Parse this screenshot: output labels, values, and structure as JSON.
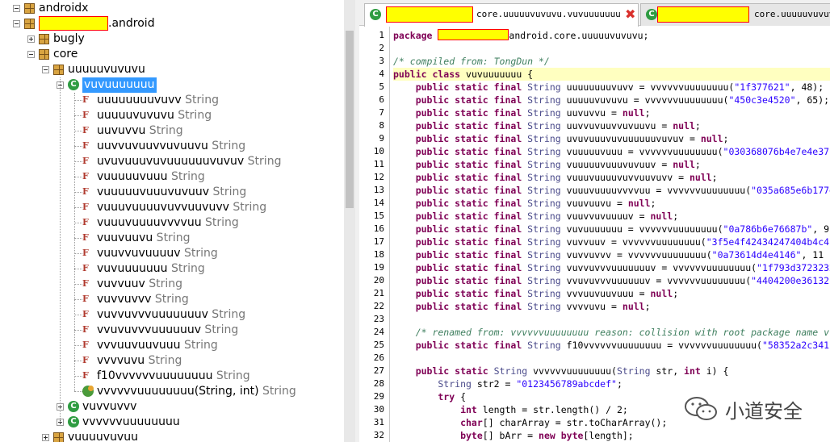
{
  "tree": {
    "nodes": [
      {
        "id": "n0",
        "depth": 0,
        "icon": "package",
        "expander": "minus",
        "label": "androidx",
        "type": ""
      },
      {
        "id": "n1",
        "depth": 0,
        "icon": "package",
        "expander": "minus",
        "label": ".android",
        "type": "",
        "redacted": true
      },
      {
        "id": "n2",
        "depth": 1,
        "icon": "package",
        "expander": "plus",
        "label": "bugly",
        "type": ""
      },
      {
        "id": "n3",
        "depth": 1,
        "icon": "package",
        "expander": "minus",
        "label": "core",
        "type": ""
      },
      {
        "id": "n4",
        "depth": 2,
        "icon": "package",
        "expander": "minus",
        "label": "uuuuuvuvuvu",
        "type": ""
      },
      {
        "id": "n5",
        "depth": 3,
        "icon": "class",
        "expander": "minus",
        "label": "vuvuuuuuuu",
        "type": "",
        "selected": true
      },
      {
        "id": "n6",
        "depth": 4,
        "icon": "field",
        "label": "uuuuuuuuvuvv",
        "type": "String"
      },
      {
        "id": "n7",
        "depth": 4,
        "icon": "field",
        "label": "uuuuuvuvuvu",
        "type": "String"
      },
      {
        "id": "n8",
        "depth": 4,
        "icon": "field",
        "label": "uuvuvvu",
        "type": "String"
      },
      {
        "id": "n9",
        "depth": 4,
        "icon": "field",
        "label": "uuvvuvuuvvuvuuvu",
        "type": "String"
      },
      {
        "id": "n10",
        "depth": 4,
        "icon": "field",
        "label": "uvuvuuuvuvuuuuuuvuvuv",
        "type": "String"
      },
      {
        "id": "n11",
        "depth": 4,
        "icon": "field",
        "label": "vuuuuuvuuu",
        "type": "String"
      },
      {
        "id": "n12",
        "depth": 4,
        "icon": "field",
        "label": "vuuuuuvuuuvuvuuv",
        "type": "String"
      },
      {
        "id": "n13",
        "depth": 4,
        "icon": "field",
        "label": "vuuuvuuuuvuvvuuvuvv",
        "type": "String"
      },
      {
        "id": "n14",
        "depth": 4,
        "icon": "field",
        "label": "vuuuvuuuuvvvvuu",
        "type": "String"
      },
      {
        "id": "n15",
        "depth": 4,
        "icon": "field",
        "label": "vuuvuuvu",
        "type": "String"
      },
      {
        "id": "n16",
        "depth": 4,
        "icon": "field",
        "label": "vuuvvuvuuuuv",
        "type": "String"
      },
      {
        "id": "n17",
        "depth": 4,
        "icon": "field",
        "label": "vuvuuuuuuu",
        "type": "String"
      },
      {
        "id": "n18",
        "depth": 4,
        "icon": "field",
        "label": "vuvvuuv",
        "type": "String"
      },
      {
        "id": "n19",
        "depth": 4,
        "icon": "field",
        "label": "vuvvuvvv",
        "type": "String"
      },
      {
        "id": "n20",
        "depth": 4,
        "icon": "field",
        "label": "vuvvuvvvuuuuuuuv",
        "type": "String"
      },
      {
        "id": "n21",
        "depth": 4,
        "icon": "field",
        "label": "vvuvuvvvuuuuuuv",
        "type": "String"
      },
      {
        "id": "n22",
        "depth": 4,
        "icon": "field",
        "label": "vvvuuvuuvuuu",
        "type": "String"
      },
      {
        "id": "n23",
        "depth": 4,
        "icon": "field",
        "label": "vvvvuvu",
        "type": "String"
      },
      {
        "id": "n24",
        "depth": 4,
        "icon": "field",
        "label": "f10vvvvvvuuuuuuuu",
        "type": "String"
      },
      {
        "id": "n25",
        "depth": 4,
        "icon": "method",
        "label": "vvvvvvuuuuuuuu(String, int)",
        "type": "String"
      },
      {
        "id": "n26",
        "depth": 3,
        "icon": "class",
        "expander": "plus",
        "label": "vuvvuvvv",
        "type": ""
      },
      {
        "id": "n27",
        "depth": 3,
        "icon": "class",
        "expander": "plus",
        "label": "vvvvvvuuuuuuuu",
        "type": ""
      },
      {
        "id": "n28",
        "depth": 2,
        "icon": "package",
        "expander": "plus",
        "label": "vuuuuvuvuu",
        "type": ""
      }
    ]
  },
  "tabs": [
    {
      "label": "core.uuuuuvuvuvu.vuvuuuuuuu",
      "active": true,
      "closable": true,
      "close_icon": "✖"
    },
    {
      "label": "core.uuuuuvuvuvu",
      "active": false
    }
  ],
  "code": {
    "lines": [
      [
        [
          "kw",
          "package "
        ],
        [
          "redact",
          ""
        ],
        [
          "plain",
          "android.core.uuuuuvuvuvu;"
        ]
      ],
      [],
      [
        [
          "cmt",
          "/* compiled from: TongDun */"
        ]
      ],
      [
        [
          "kw",
          "public class "
        ],
        [
          "plain",
          "vuvuuuuuuu {"
        ]
      ],
      [
        [
          "kw",
          "    public static final "
        ],
        [
          "ty",
          "String "
        ],
        [
          "plain",
          "uuuuuuuuvuvv = vvvvvvuuuuuuuu("
        ],
        [
          "str",
          "\"1f377621\""
        ],
        [
          "plain",
          ", 48);"
        ]
      ],
      [
        [
          "kw",
          "    public static final "
        ],
        [
          "ty",
          "String "
        ],
        [
          "plain",
          "uuuuuvuvuvu = vvvvvvuuuuuuuu("
        ],
        [
          "str",
          "\"450c3e4520\""
        ],
        [
          "plain",
          ", 65);"
        ]
      ],
      [
        [
          "kw",
          "    public static final "
        ],
        [
          "ty",
          "String "
        ],
        [
          "plain",
          "uuvuvvu = "
        ],
        [
          "kw",
          "null"
        ],
        [
          "plain",
          ";"
        ]
      ],
      [
        [
          "kw",
          "    public static final "
        ],
        [
          "ty",
          "String "
        ],
        [
          "plain",
          "uuvvuvuuvvuvuuvu = "
        ],
        [
          "kw",
          "null"
        ],
        [
          "plain",
          ";"
        ]
      ],
      [
        [
          "kw",
          "    public static final "
        ],
        [
          "ty",
          "String "
        ],
        [
          "plain",
          "uvuvuuuvuvuuuuuuvuvuv = "
        ],
        [
          "kw",
          "null"
        ],
        [
          "plain",
          ";"
        ]
      ],
      [
        [
          "kw",
          "    public static final "
        ],
        [
          "ty",
          "String "
        ],
        [
          "plain",
          "vuuuuuvuuu = vvvvvvuuuuuuuu("
        ],
        [
          "str",
          "\"030368076b4e7e4e37"
        ]
      ],
      [
        [
          "kw",
          "    public static final "
        ],
        [
          "ty",
          "String "
        ],
        [
          "plain",
          "vuuuuuvuuuvuvuuv = "
        ],
        [
          "kw",
          "null"
        ],
        [
          "plain",
          ";"
        ]
      ],
      [
        [
          "kw",
          "    public static final "
        ],
        [
          "ty",
          "String "
        ],
        [
          "plain",
          "vuuuvuuuuvuvvuuvuvv = "
        ],
        [
          "kw",
          "null"
        ],
        [
          "plain",
          ";"
        ]
      ],
      [
        [
          "kw",
          "    public static final "
        ],
        [
          "ty",
          "String "
        ],
        [
          "plain",
          "vuuuvuuuuvvvvuu = vvvvvvuuuuuuuu("
        ],
        [
          "str",
          "\"035a685e6b177e"
        ]
      ],
      [
        [
          "kw",
          "    public static final "
        ],
        [
          "ty",
          "String "
        ],
        [
          "plain",
          "vuuvuuvu = "
        ],
        [
          "kw",
          "null"
        ],
        [
          "plain",
          ";"
        ]
      ],
      [
        [
          "kw",
          "    public static final "
        ],
        [
          "ty",
          "String "
        ],
        [
          "plain",
          "vuuvvuvuuuuv = "
        ],
        [
          "kw",
          "null"
        ],
        [
          "plain",
          ";"
        ]
      ],
      [
        [
          "kw",
          "    public static final "
        ],
        [
          "ty",
          "String "
        ],
        [
          "plain",
          "vuvuuuuuuu = vvvvvvuuuuuuuu("
        ],
        [
          "str",
          "\"0a786b6e76687b\""
        ],
        [
          "plain",
          ", 9"
        ]
      ],
      [
        [
          "kw",
          "    public static final "
        ],
        [
          "ty",
          "String "
        ],
        [
          "plain",
          "vuvvuuv = vvvvvvuuuuuuuu("
        ],
        [
          "str",
          "\"3f5e4f42434247404b4c4"
        ]
      ],
      [
        [
          "kw",
          "    public static final "
        ],
        [
          "ty",
          "String "
        ],
        [
          "plain",
          "vuvvuvvv = vvvvvvuuuuuuuu("
        ],
        [
          "str",
          "\"0a73614d4e4146\""
        ],
        [
          "plain",
          ", 11"
        ]
      ],
      [
        [
          "kw",
          "    public static final "
        ],
        [
          "ty",
          "String "
        ],
        [
          "plain",
          "vuvvuvvvuuuuuuuv = vvvvvvuuuuuuuu("
        ],
        [
          "str",
          "\"1f793d3723232"
        ]
      ],
      [
        [
          "kw",
          "    public static final "
        ],
        [
          "ty",
          "String "
        ],
        [
          "plain",
          "vvuvuvvvuuuuuuv = vvvvvvuuuuuuuu("
        ],
        [
          "str",
          "\"4404200e36132"
        ]
      ],
      [
        [
          "kw",
          "    public static final "
        ],
        [
          "ty",
          "String "
        ],
        [
          "plain",
          "vvvuuvuuvuuu = "
        ],
        [
          "kw",
          "null"
        ],
        [
          "plain",
          ";"
        ]
      ],
      [
        [
          "kw",
          "    public static final "
        ],
        [
          "ty",
          "String "
        ],
        [
          "plain",
          "vvvvuvu = "
        ],
        [
          "kw",
          "null"
        ],
        [
          "plain",
          ";"
        ]
      ],
      [],
      [
        [
          "cmt",
          "    /* renamed from: vvvvvvuuuuuuuu reason: collision with root package name v"
        ]
      ],
      [
        [
          "kw",
          "    public static final "
        ],
        [
          "ty",
          "String "
        ],
        [
          "plain",
          "f10vvvvvvuuuuuuuu = vvvvvvuuuuuuuu("
        ],
        [
          "str",
          "\"58352a2c341"
        ]
      ],
      [],
      [
        [
          "kw",
          "    public static "
        ],
        [
          "ty",
          "String "
        ],
        [
          "plain",
          "vvvvvvuuuuuuuu("
        ],
        [
          "ty",
          "String "
        ],
        [
          "plain",
          "str, "
        ],
        [
          "kw",
          "int "
        ],
        [
          "plain",
          "i) {"
        ]
      ],
      [
        [
          "ty",
          "        String "
        ],
        [
          "plain",
          "str2 = "
        ],
        [
          "str",
          "\"0123456789abcdef\""
        ],
        [
          "plain",
          ";"
        ]
      ],
      [
        [
          "kw",
          "        try "
        ],
        [
          "plain",
          "{"
        ]
      ],
      [
        [
          "kw",
          "            int "
        ],
        [
          "plain",
          "length = str.length() / 2;"
        ]
      ],
      [
        [
          "kw",
          "            char"
        ],
        [
          "plain",
          "[] charArray = str.toCharArray();"
        ]
      ],
      [
        [
          "kw",
          "            byte"
        ],
        [
          "plain",
          "[] bArr = "
        ],
        [
          "kw",
          "new byte"
        ],
        [
          "plain",
          "[length];"
        ]
      ]
    ],
    "highlight_line": 4
  },
  "watermark": {
    "text": "小道安全"
  }
}
